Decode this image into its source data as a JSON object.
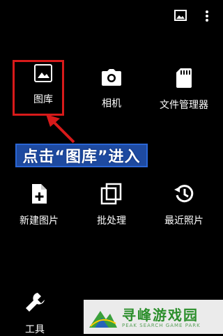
{
  "topbar": {
    "image_icon": "image-icon",
    "more_icon": "more-vert-icon"
  },
  "grid": {
    "items": [
      {
        "label": "图库",
        "icon": "image-icon"
      },
      {
        "label": "相机",
        "icon": "camera-icon"
      },
      {
        "label": "文件管理器",
        "icon": "sd-card-icon"
      },
      {
        "label": "新建图片",
        "icon": "new-file-icon"
      },
      {
        "label": "批处理",
        "icon": "copy-icon"
      },
      {
        "label": "最近照片",
        "icon": "history-icon"
      },
      {
        "label": "工具",
        "icon": "wrench-icon"
      }
    ]
  },
  "annotation": {
    "callout_text": "点击“图库”进入",
    "highlight_color": "#d81a1a",
    "callout_bg": "#1e4aa0"
  },
  "watermark": {
    "title": "寻峰游戏园",
    "subtitle": "PEAK SEARCH GAME PARK"
  }
}
